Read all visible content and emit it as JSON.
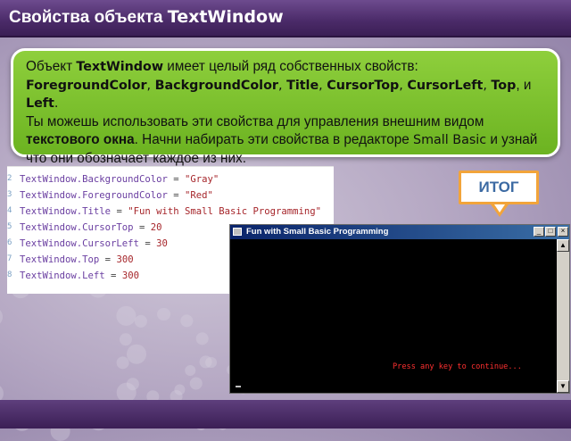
{
  "header": {
    "title_part1": "Свойства объекта ",
    "title_part2": "TextWindow"
  },
  "intro": {
    "t1": "Объект ",
    "t2": "TextWindow",
    "t3": " имеет  целый ряд собственных свойств:",
    "p1": "ForegroundColor",
    "s1": ", ",
    "p2": "BackgroundColor",
    "s2": ", ",
    "p3": "Title",
    "s3": ", ",
    "p4": "CursorTop",
    "s4": ", ",
    "p5": "CursorLeft",
    "s5": ", ",
    "p6": "Top",
    "s6": ", и ",
    "p7": "Left",
    "s7": ".",
    "t4": "Ты можешь использовать эти свойства для управления внешним видом ",
    "t5": "текстового окна",
    "t6": ". Начни набирать эти свойства в редакторе ",
    "t7": "Small Basic",
    "t8": " и узнай что они обозначает каждое из них."
  },
  "code": [
    {
      "ln": "2",
      "obj": "TextWindow",
      "prop": ".BackgroundColor",
      "eq": " = ",
      "val": "\"Gray\""
    },
    {
      "ln": "3",
      "obj": "TextWindow",
      "prop": ".ForegroundColor",
      "eq": " = ",
      "val": "\"Red\""
    },
    {
      "ln": "4",
      "obj": "TextWindow",
      "prop": ".Title",
      "eq": " = ",
      "val": "\"Fun with Small Basic Programming\""
    },
    {
      "ln": "5",
      "obj": "TextWindow",
      "prop": ".CursorTop",
      "eq": " = ",
      "val": "20"
    },
    {
      "ln": "6",
      "obj": "TextWindow",
      "prop": ".CursorLeft",
      "eq": " = ",
      "val": "30"
    },
    {
      "ln": "7",
      "obj": "TextWindow",
      "prop": ".Top",
      "eq": " = ",
      "val": "300"
    },
    {
      "ln": "8",
      "obj": "TextWindow",
      "prop": ".Left",
      "eq": " = ",
      "val": "300"
    }
  ],
  "itog_label": "ИТОГ",
  "window": {
    "title": "Fun with Small Basic Programming",
    "minimize_glyph": "_",
    "maximize_glyph": "□",
    "close_glyph": "×",
    "console_text": "Press any key to continue...",
    "scroll_up_glyph": "▲",
    "scroll_down_glyph": "▼"
  },
  "colors": {
    "header_bg": "#4a2a68",
    "box_green": "#7cc22e",
    "itog_border": "#f2a43a",
    "itog_text": "#3c6aa3",
    "console_red": "#ff3030"
  }
}
